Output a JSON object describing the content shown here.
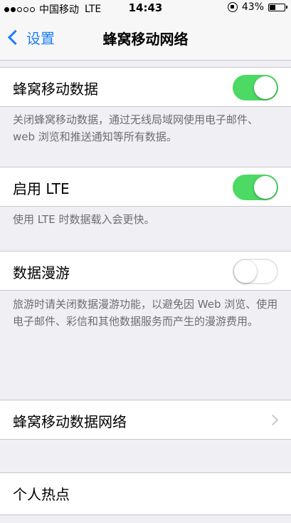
{
  "status_bar": {
    "carrier": "中国移动",
    "network": "LTE",
    "time": "14:43",
    "battery": "43%",
    "battery_level": 0.43
  },
  "nav": {
    "back_label": "设置",
    "title": "蜂窝移动网络"
  },
  "cells": {
    "cellular_data": {
      "label": "蜂窝移动数据",
      "on": true
    },
    "cellular_data_footer": "关闭蜂窝移动数据，通过无线局域网使用电子邮件、web 浏览和推送通知等所有数据。",
    "enable_lte": {
      "label": "启用 LTE",
      "on": true
    },
    "enable_lte_footer": "使用 LTE 时数据载入会更快。",
    "data_roaming": {
      "label": "数据漫游",
      "on": false
    },
    "data_roaming_footer": "旅游时请关闭数据漫游功能，以避免因 Web 浏览、使用电子邮件、彩信和其他数据服务而产生的漫游费用。",
    "cellular_data_network": {
      "label": "蜂窝移动数据网络"
    },
    "personal_hotspot": {
      "label": "个人热点"
    }
  },
  "colors": {
    "tint": "#1b7ef6",
    "switch_on": "#4cd964",
    "background": "#efeff4"
  }
}
